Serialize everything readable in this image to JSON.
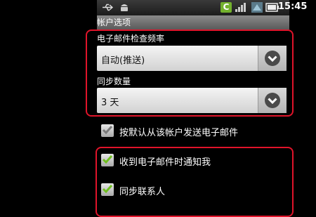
{
  "status_bar": {
    "time": "15:45",
    "carrier_badge": "C",
    "icons": [
      "usb-icon",
      "android-icon",
      "carrier-icon",
      "signal-icon",
      "wifi-icon",
      "battery-icon"
    ]
  },
  "header": {
    "title": "帐户选项"
  },
  "email_check_frequency": {
    "label": "电子邮件检查频率",
    "value": "自动(推送)"
  },
  "sync_count": {
    "label": "同步数量",
    "value": "3 天"
  },
  "checkboxes": [
    {
      "label": "按默认从该帐户发送电子邮件",
      "checked": true,
      "enabled": false
    },
    {
      "label": "收到电子邮件时通知我",
      "checked": true,
      "enabled": true
    },
    {
      "label": "同步联系人",
      "checked": true,
      "enabled": true
    }
  ],
  "colors": {
    "highlight_box": "#e0142a",
    "check_green": "#6fbf1f",
    "header_bg": "#6e6e6e"
  }
}
